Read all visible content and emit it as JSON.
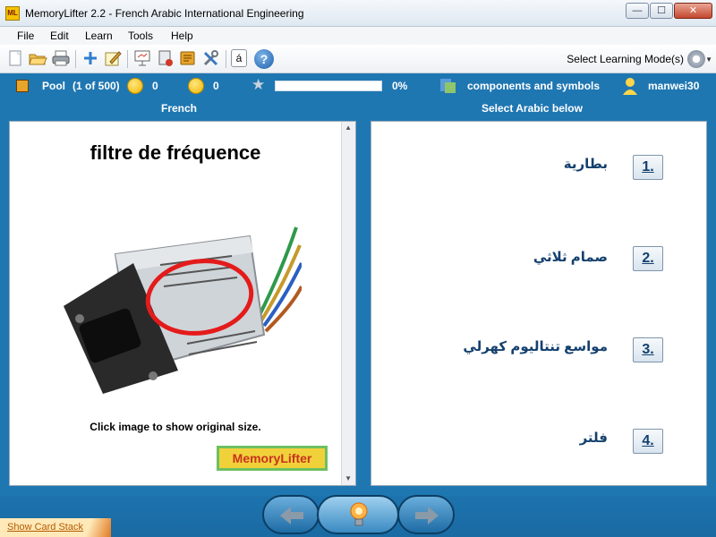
{
  "window": {
    "title": "MemoryLifter 2.2 - French Arabic International Engineering",
    "icon_text": "ML",
    "buttons": {
      "minimize": "—",
      "maximize": "☐",
      "close": "✕"
    }
  },
  "menu": [
    "File",
    "Edit",
    "Learn",
    "Tools",
    "Help"
  ],
  "toolbar": {
    "icons": [
      "new-icon",
      "open-icon",
      "print-icon",
      "add-icon",
      "edit-icon",
      "presentation-icon",
      "card-stack-icon",
      "notes-icon",
      "tools-icon",
      "character-icon",
      "help-icon"
    ],
    "character_label": "á",
    "help_label": "?",
    "learn_mode_label": "Select Learning Mode(s)"
  },
  "status": {
    "pool_label": "Pool",
    "pool_count": "(1 of 500)",
    "correct_count": "0",
    "wrong_count": "0",
    "progress_percent": "0%",
    "progress_fraction": 0.0,
    "chapter": "components and symbols",
    "user": "manwei30"
  },
  "question": {
    "header": "French",
    "word": "filtre de fréquence",
    "image_hint": "Click image to show original size.",
    "logo_text": "MemoryLifter"
  },
  "answers": {
    "header": "Select Arabic below",
    "options": [
      {
        "number": "1.",
        "text": "بطارية"
      },
      {
        "number": "2.",
        "text": "صمام ثلاثي"
      },
      {
        "number": "3.",
        "text": "مواسع تنتاليوم كهرلي"
      },
      {
        "number": "4.",
        "text": "فلتر"
      }
    ]
  },
  "footer": {
    "show_card_stack": "Show Card Stack",
    "nav_prev_icon": "left-arrow-icon",
    "nav_hint_icon": "lightbulb-icon",
    "nav_next_icon": "right-arrow-icon"
  },
  "colors": {
    "accent_blue": "#1f77b2",
    "answer_text": "#14406e",
    "progress_green": "#7ac35a"
  }
}
